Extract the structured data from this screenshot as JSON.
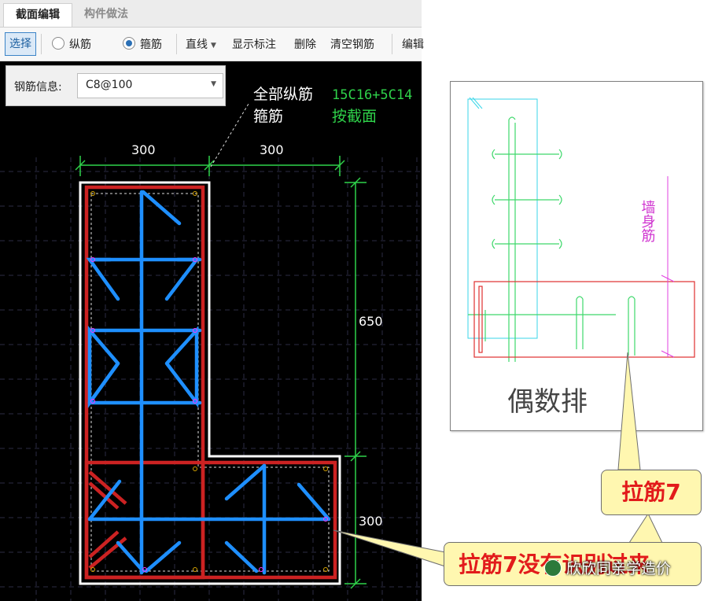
{
  "tabs": [
    {
      "label": "截面编辑",
      "active": true
    },
    {
      "label": "构件做法",
      "active": false
    }
  ],
  "toolbar": {
    "select_label": "选择",
    "radio_longitudinal": "纵筋",
    "radio_stirrup": "箍筋",
    "selected_radio": "箍筋",
    "line_label": "直线",
    "show_annotation": "显示标注",
    "delete_label": "删除",
    "clear_rebar": "清空钢筋",
    "edit_label": "编辑"
  },
  "rebar_info": {
    "label": "钢筋信息:",
    "value": "C8@100"
  },
  "canvas": {
    "label_all_long": "全部纵筋",
    "label_stirrup": "箍筋",
    "value_long": "15C16+5C14",
    "value_stirrup": "按截面",
    "dim_top_left": "300",
    "dim_top_right": "300",
    "dim_right_upper": "650",
    "dim_right_lower": "300"
  },
  "photo": {
    "vertical_label": "墙身筋",
    "caption": "偶数排"
  },
  "callouts": {
    "tie_label": "拉筋7",
    "tie_not_recognized": "拉筋7没有识别过来"
  },
  "watermark": "欣欣同亲学造价",
  "colors": {
    "canvas_bg": "#000000",
    "rebar_red": "#cc2222",
    "stirrup_blue": "#1e8fff",
    "dimension_green": "#2fd24a",
    "callout_text": "#e21b1b",
    "callout_bg": "#fff7b0"
  }
}
